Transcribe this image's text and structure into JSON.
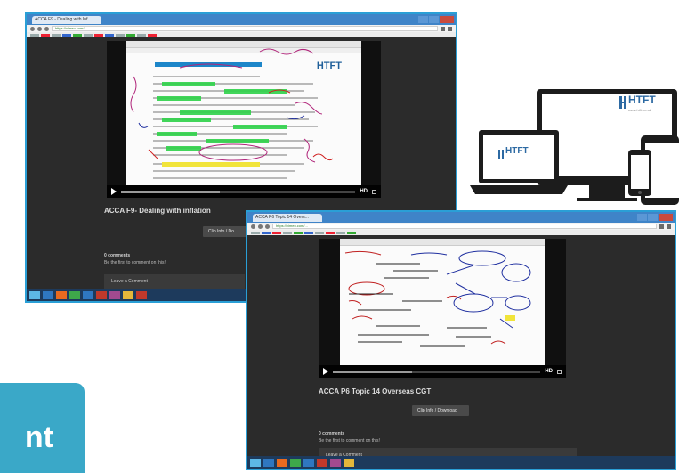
{
  "screen1": {
    "tab_title": "ACCA F9 - Dealing with Inf...",
    "url": "https://vimeo.com/...",
    "logo_text": "HTFT",
    "video_title": "ACCA F9- Dealing with inflation",
    "clip_button": "Clip Info / Do",
    "comments_count": "0 comments",
    "comments_hint": "Be the first to comment on this!",
    "leave_comment": "Leave a Comment",
    "hd_label": "HD",
    "progress": 0.42
  },
  "screen2": {
    "tab_title": "ACCA P6 Topic 14 Overs...",
    "url": "https://vimeo.com/...",
    "video_title": "ACCA P6 Topic 14 Overseas CGT",
    "clip_button": "Clip Info / Download",
    "comments_count": "0 comments",
    "comments_hint": "Be the first to comment on this!",
    "leave_comment": "Leave a Comment",
    "hd_label": "HD",
    "progress": 0.38
  },
  "devices": {
    "monitor_logo": "HTFT",
    "laptop_logo": "HTFT",
    "tagline": "www.htft.co.uk"
  },
  "promo": {
    "text": "nt"
  },
  "colors": {
    "accent_blue": "#2a9fd6",
    "promo_teal": "#3aa8c8",
    "dark_bg": "#2b2b2b",
    "highlight_green": "#2fd34a",
    "highlight_yellow": "#f1e43a"
  }
}
